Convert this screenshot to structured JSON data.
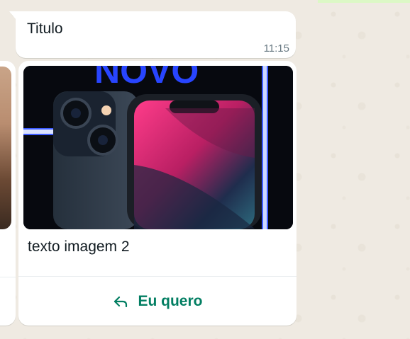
{
  "title_message": {
    "text": "Titulo",
    "time": "11:15"
  },
  "carousel_card": {
    "image_banner_text": "NOVO",
    "caption": "texto imagem 2",
    "reply_button": {
      "label": "Eu quero",
      "icon": "reply-arrow-icon"
    }
  },
  "colors": {
    "chat_background": "#efeae2",
    "bubble": "#ffffff",
    "button_text": "#027e62",
    "meta_text": "#667781"
  }
}
